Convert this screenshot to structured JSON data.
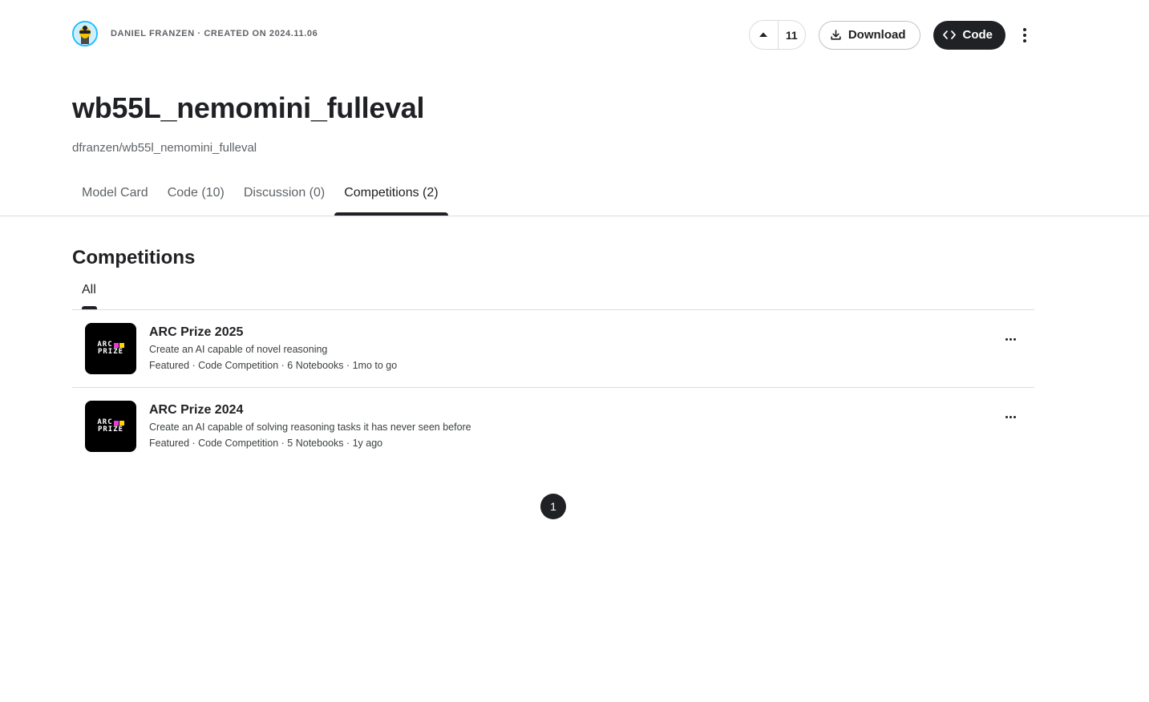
{
  "header": {
    "owner_line": "DANIEL FRANZEN · CREATED ON 2024.11.06",
    "vote_count": "11",
    "download_label": "Download",
    "code_label": "Code",
    "icons": {
      "avatar": "avatar-icon",
      "upvote": "caret-up-icon",
      "download": "download-icon",
      "code": "code-brackets-icon",
      "more": "more-vertical-icon"
    }
  },
  "model": {
    "title": "wb55L_nemomini_fulleval",
    "slug": "dfranzen/wb55l_nemomini_fulleval"
  },
  "tabs": [
    {
      "label": "Model Card",
      "active": false
    },
    {
      "label": "Code (10)",
      "active": false
    },
    {
      "label": "Discussion (0)",
      "active": false
    },
    {
      "label": "Competitions (2)",
      "active": true
    }
  ],
  "section": {
    "title": "Competitions",
    "filter_tab": "All"
  },
  "competitions": [
    {
      "name": "ARC Prize 2025",
      "description": "Create an AI capable of novel reasoning",
      "meta": "Featured · Code Competition · 6 Notebooks · 1mo to go",
      "logo_line1": "ARC",
      "logo_line2": "PRIZE"
    },
    {
      "name": "ARC Prize 2024",
      "description": "Create an AI capable of solving reasoning tasks it has never seen before",
      "meta": "Featured · Code Competition · 5 Notebooks · 1y ago",
      "logo_line1": "ARC",
      "logo_line2": "PRIZE"
    }
  ],
  "pagination": {
    "current_page": "1"
  },
  "colors": {
    "text_primary": "#202124",
    "text_secondary": "#5f6368",
    "divider": "#dadce0",
    "avatar_ring": "#20beff",
    "logo_pink": "#e83ad8",
    "logo_yellow": "#ffd600"
  }
}
